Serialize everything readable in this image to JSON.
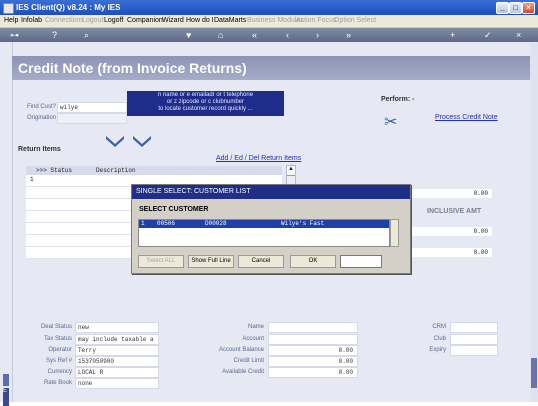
{
  "window": {
    "title": "IES Client(Q) v8.24 : My IES"
  },
  "menu": [
    "Help",
    "Infolab",
    "Connections",
    "Logout",
    "Logoff",
    "Companion",
    "Wizard",
    "How do I",
    "DataMarts",
    "Business Modules",
    "Action Focus",
    "Option Select"
  ],
  "menu_disabled": [
    false,
    false,
    true,
    true,
    false,
    false,
    false,
    false,
    false,
    true,
    true,
    true
  ],
  "page": {
    "title": "Credit Note (from Invoice Returns)"
  },
  "form": {
    "find_cust_label": "Find Cust?",
    "find_cust_value": "wilye",
    "origination_label": "Origination",
    "tooltip": [
      "n name or e emailadr or t telephone",
      "or z zipcode or c clubnumber",
      "to locate customer record quickly ..."
    ],
    "perform_label": "Perform: -",
    "process_link": "Process Credit Note"
  },
  "return_items": {
    "label": "Return Items",
    "edit_link": "Add / Ed / Del Return Items",
    "columns": [
      ">>> Status",
      "Description"
    ],
    "first_row_index": "1",
    "inclusive_amt_label": "INCLUSIVE AMT",
    "amounts": [
      "0.00",
      "0.00",
      "0.00"
    ]
  },
  "dialog": {
    "title": "SINGLE SELECT: CUSTOMER LIST",
    "subtitle": "SELECT CUSTOMER",
    "row": {
      "index": "1",
      "code": "00506",
      "doc": "D00028",
      "name": "Wilye's Fast"
    },
    "buttons": {
      "select_all": "Select ALL",
      "show_full": "Show Full Line",
      "cancel": "Cancel",
      "ok": "OK"
    }
  },
  "details_left": [
    {
      "label": "Deal Status",
      "value": "new"
    },
    {
      "label": "Tax Status",
      "value": "may include taxable a"
    },
    {
      "label": "Operator",
      "value": "Terry"
    },
    {
      "label": "Sys Ref #",
      "value": "1537050900"
    },
    {
      "label": "Currency",
      "value": "LOCAL R"
    },
    {
      "label": "Rate Book",
      "value": "none"
    }
  ],
  "details_mid": [
    {
      "label": "Name",
      "value": ""
    },
    {
      "label": "Account",
      "value": ""
    },
    {
      "label": "Account Balance",
      "value": "0.00"
    },
    {
      "label": "Credit Limit",
      "value": "0.00"
    },
    {
      "label": "Available Credit",
      "value": "0.00"
    }
  ],
  "details_right": [
    {
      "label": "CRM",
      "value": ""
    },
    {
      "label": "Club",
      "value": ""
    },
    {
      "label": "Expiry",
      "value": ""
    }
  ]
}
